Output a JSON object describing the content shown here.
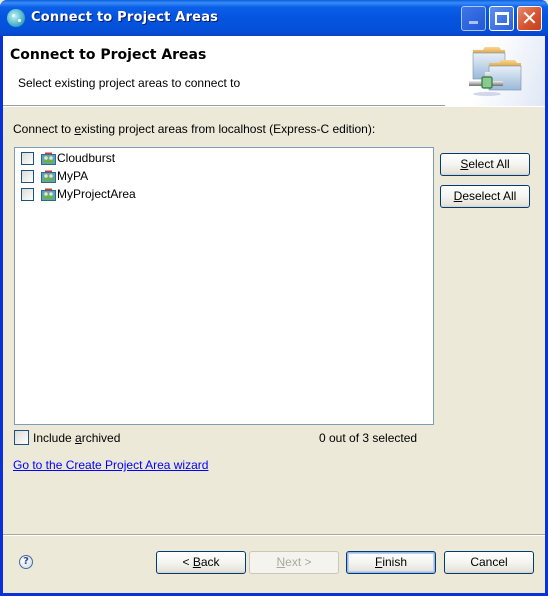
{
  "window": {
    "title": "Connect to Project Areas",
    "controls": {
      "minimize_icon": "minimize-icon",
      "maximize_icon": "maximize-icon",
      "close_icon": "close-icon",
      "close_glyph": "✕"
    }
  },
  "header": {
    "title": "Connect to Project Areas",
    "subtitle": "Select existing project areas to connect to",
    "banner_icon": "project-area-connect-icon"
  },
  "main": {
    "label_prefix": "Connect to ",
    "label_mnemonic": "e",
    "label_suffix": "xisting project areas from localhost (Express-C edition):",
    "project_areas": [
      {
        "name": "Cloudburst",
        "checked": false,
        "icon": "project-area-icon"
      },
      {
        "name": "MyPA",
        "checked": false,
        "icon": "project-area-icon"
      },
      {
        "name": "MyProjectArea",
        "checked": false,
        "icon": "project-area-icon"
      }
    ],
    "select_all": {
      "mnemonic": "S",
      "rest": "elect All"
    },
    "deselect_all": {
      "mnemonic": "D",
      "rest": "eselect All"
    },
    "include_archived": {
      "prefix": "Include ",
      "mnemonic": "a",
      "rest": "rchived",
      "checked": false
    },
    "selection_count": "0 out of 3 selected",
    "wizard_link": "Go to the Create Project Area wizard"
  },
  "footer": {
    "help_glyph": "?",
    "back": {
      "prefix": "< ",
      "mnemonic": "B",
      "rest": "ack",
      "enabled": true
    },
    "next": {
      "mnemonic": "N",
      "rest": "ext >",
      "enabled": false
    },
    "finish": {
      "mnemonic": "F",
      "rest": "inish",
      "enabled": true
    },
    "cancel": {
      "label": "Cancel",
      "enabled": true
    }
  },
  "colors": {
    "titlebar": "#0554e0",
    "dialog_bg": "#ece9d8",
    "link": "#0000ff",
    "list_border": "#7f9db9",
    "button_border": "#003c74"
  }
}
